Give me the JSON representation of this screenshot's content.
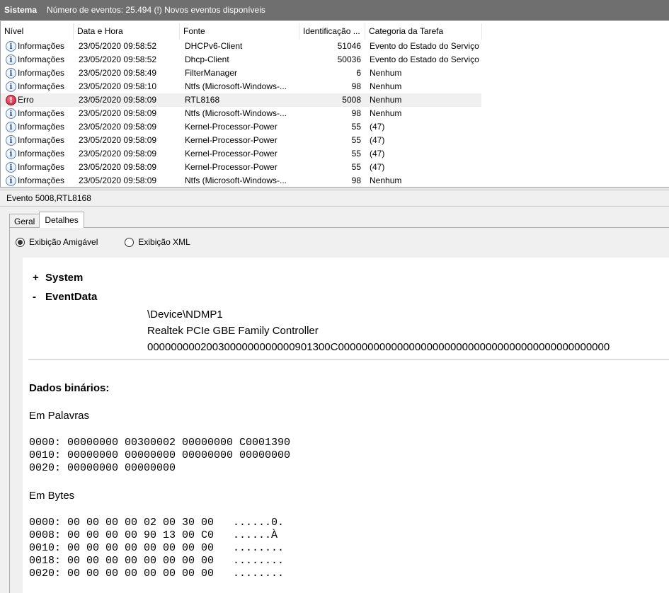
{
  "header": {
    "name": "Sistema",
    "count_text": "Número de eventos: 25.494 (!) Novos eventos disponíveis"
  },
  "columns": {
    "level": "Nível",
    "date": "Data e Hora",
    "source": "Fonte",
    "id": "Identificação ...",
    "category": "Categoria da Tarefa"
  },
  "events": [
    {
      "icon": "info-icon",
      "level": "Informações",
      "date": "23/05/2020 09:58:52",
      "source": "DHCPv6-Client",
      "id": "51046",
      "category": "Evento do Estado do Serviço"
    },
    {
      "icon": "info-icon",
      "level": "Informações",
      "date": "23/05/2020 09:58:52",
      "source": "Dhcp-Client",
      "id": "50036",
      "category": "Evento do Estado do Serviço"
    },
    {
      "icon": "info-icon",
      "level": "Informações",
      "date": "23/05/2020 09:58:49",
      "source": "FilterManager",
      "id": "6",
      "category": "Nenhum"
    },
    {
      "icon": "info-icon",
      "level": "Informações",
      "date": "23/05/2020 09:58:10",
      "source": "Ntfs (Microsoft-Windows-...",
      "id": "98",
      "category": "Nenhum"
    },
    {
      "icon": "error-icon",
      "level": "Erro",
      "date": "23/05/2020 09:58:09",
      "source": "RTL8168",
      "id": "5008",
      "category": "Nenhum",
      "selected": true
    },
    {
      "icon": "info-icon",
      "level": "Informações",
      "date": "23/05/2020 09:58:09",
      "source": "Ntfs (Microsoft-Windows-...",
      "id": "98",
      "category": "Nenhum"
    },
    {
      "icon": "info-icon",
      "level": "Informações",
      "date": "23/05/2020 09:58:09",
      "source": "Kernel-Processor-Power",
      "id": "55",
      "category": "(47)"
    },
    {
      "icon": "info-icon",
      "level": "Informações",
      "date": "23/05/2020 09:58:09",
      "source": "Kernel-Processor-Power",
      "id": "55",
      "category": "(47)"
    },
    {
      "icon": "info-icon",
      "level": "Informações",
      "date": "23/05/2020 09:58:09",
      "source": "Kernel-Processor-Power",
      "id": "55",
      "category": "(47)"
    },
    {
      "icon": "info-icon",
      "level": "Informações",
      "date": "23/05/2020 09:58:09",
      "source": "Kernel-Processor-Power",
      "id": "55",
      "category": "(47)"
    },
    {
      "icon": "info-icon",
      "level": "Informações",
      "date": "23/05/2020 09:58:09",
      "source": "Ntfs (Microsoft-Windows-...",
      "id": "98",
      "category": "Nenhum"
    }
  ],
  "event_title": "Evento 5008,RTL8168",
  "tabs": [
    "Geral",
    "Detalhes"
  ],
  "view_modes": {
    "friendly": "Exibição Amigável",
    "xml": "Exibição XML"
  },
  "details": {
    "system_sign": "+",
    "system_label": "System",
    "eventdata_sign": "-",
    "eventdata_label": "EventData",
    "values": [
      "\\Device\\NDMP1",
      "Realtek PCIe GBE Family Controller",
      "0000000002003000000000000901300C0000000000000000000000000000000000000000000000"
    ],
    "binary_title": "Dados binários:",
    "words_title": "Em Palavras",
    "words_lines": [
      "0000: 00000000 00300002 00000000 C0001390",
      "0010: 00000000 00000000 00000000 00000000",
      "0020: 00000000 00000000"
    ],
    "bytes_title": "Em Bytes",
    "bytes_lines": [
      "0000: 00 00 00 00 02 00 30 00   ......0.",
      "0008: 00 00 00 00 90 13 00 C0   ......À",
      "0010: 00 00 00 00 00 00 00 00   ........",
      "0018: 00 00 00 00 00 00 00 00   ........",
      "0020: 00 00 00 00 00 00 00 00   ........"
    ]
  }
}
